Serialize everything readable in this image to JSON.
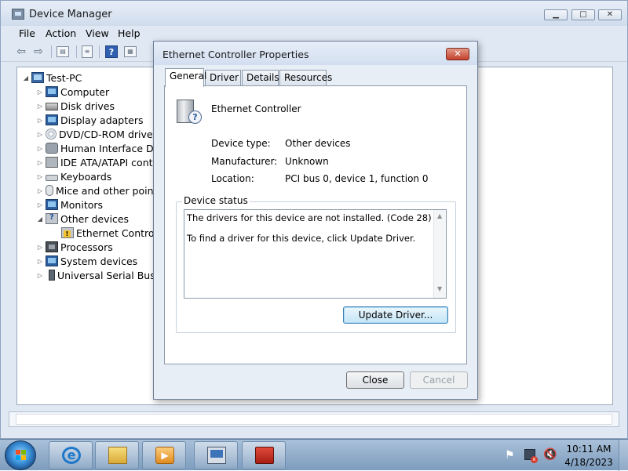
{
  "device_manager": {
    "title": "Device Manager",
    "caption_buttons": {
      "minimize": "▁",
      "maximize": "□",
      "close": "✕"
    },
    "menu": [
      "File",
      "Action",
      "View",
      "Help"
    ],
    "toolbar_icons": [
      "back-arrow-icon",
      "forward-arrow-icon",
      "tree-view-icon",
      "properties-icon",
      "help-icon",
      "grid-view-icon"
    ],
    "tree": {
      "root": "Test-PC",
      "items": [
        {
          "label": "Computer",
          "icon": "computer-icon"
        },
        {
          "label": "Disk drives",
          "icon": "disk-drive-icon"
        },
        {
          "label": "Display adapters",
          "icon": "display-adapter-icon"
        },
        {
          "label": "DVD/CD-ROM drives",
          "icon": "dvd-drive-icon"
        },
        {
          "label": "Human Interface Devi",
          "icon": "hid-icon"
        },
        {
          "label": "IDE ATA/ATAPI contro",
          "icon": "ide-controller-icon"
        },
        {
          "label": "Keyboards",
          "icon": "keyboard-icon"
        },
        {
          "label": "Mice and other pointi",
          "icon": "mouse-icon"
        },
        {
          "label": "Monitors",
          "icon": "monitor-icon"
        },
        {
          "label": "Other devices",
          "icon": "unknown-device-icon",
          "expanded": true
        },
        {
          "label": "Ethernet Controlle",
          "icon": "warning-device-icon",
          "child": true
        },
        {
          "label": "Processors",
          "icon": "processor-icon"
        },
        {
          "label": "System devices",
          "icon": "system-device-icon"
        },
        {
          "label": "Universal Serial Bus co",
          "icon": "usb-icon"
        }
      ]
    }
  },
  "dialog": {
    "title": "Ethernet Controller Properties",
    "close_glyph": "✕",
    "tabs": [
      "General",
      "Driver",
      "Details",
      "Resources"
    ],
    "active_tab": "General",
    "device_name": "Ethernet Controller",
    "info": {
      "device_type_label": "Device type:",
      "device_type_value": "Other devices",
      "manufacturer_label": "Manufacturer:",
      "manufacturer_value": "Unknown",
      "location_label": "Location:",
      "location_value": "PCI bus 0, device 1, function 0"
    },
    "status": {
      "legend": "Device status",
      "line1": "The drivers for this device are not installed. (Code 28)",
      "line2": "To find a driver for this device, click Update Driver."
    },
    "buttons": {
      "update_driver": "Update Driver...",
      "close": "Close",
      "cancel": "Cancel"
    }
  },
  "taskbar": {
    "apps": [
      "internet-explorer-icon",
      "windows-explorer-icon",
      "media-player-icon",
      "device-manager-icon",
      "toolbox-icon"
    ],
    "tray": [
      "action-center-flag-icon",
      "network-disconnected-icon",
      "volume-muted-icon"
    ],
    "clock_time": "10:11 AM",
    "clock_date": "4/18/2023"
  },
  "colors": {
    "window_chrome": "#dfe8f3",
    "dialog_close_red": "#c4402a",
    "taskbar": "#7d9cbd",
    "update_button_accent": "#3c7fb1"
  }
}
